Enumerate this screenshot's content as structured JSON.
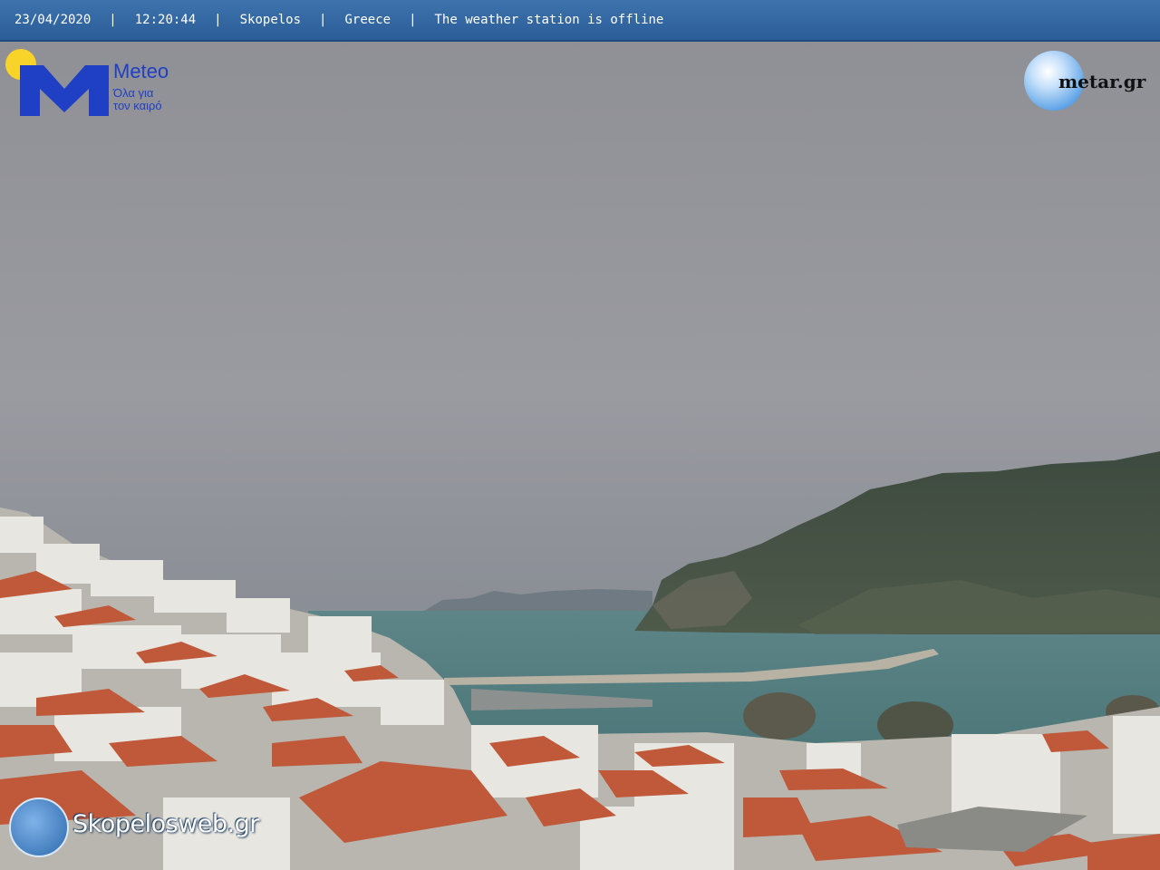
{
  "overlay": {
    "date": "23/04/2020",
    "time": "12:20:44",
    "location": "Skopelos",
    "country": "Greece",
    "status": "The weather station is offline",
    "separator": "|"
  },
  "logos": {
    "meteo": {
      "word": "Meteo",
      "tagline_1": "Όλα για",
      "tagline_2": "τον καιρό"
    },
    "metar": "metar.gr",
    "skopelosweb": "Skopelosweb.gr"
  },
  "colors": {
    "bar_bg": "#2f62a0",
    "meteo_blue": "#1f3fc4",
    "meteo_sun": "#f8d32a",
    "roof_tile": "#c0583a",
    "sea": "#4d7b7d",
    "sky": "#8f9299"
  }
}
